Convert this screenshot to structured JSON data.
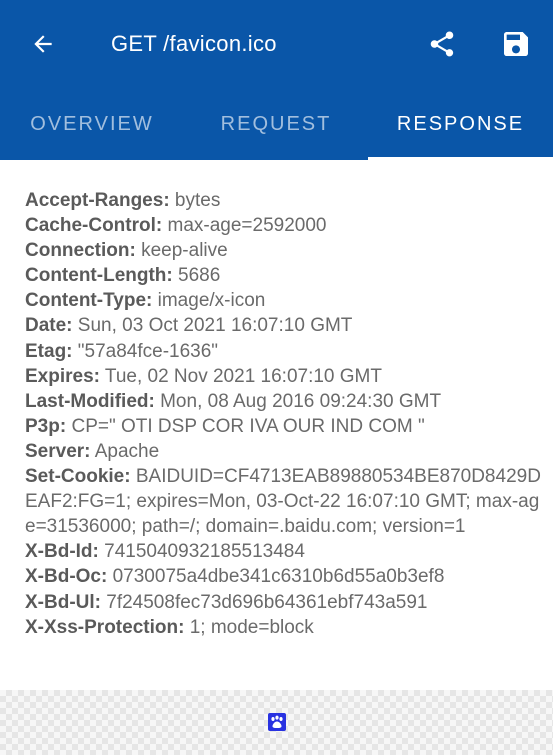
{
  "toolbar": {
    "title": "GET /favicon.ico",
    "back_icon": "arrow-back-icon",
    "share_icon": "share-icon",
    "save_icon": "save-icon"
  },
  "tabs": [
    {
      "label": "OVERVIEW",
      "selected": false
    },
    {
      "label": "REQUEST",
      "selected": false
    },
    {
      "label": "RESPONSE",
      "selected": true
    }
  ],
  "headers": [
    {
      "name": "Accept-Ranges:",
      "value": " bytes"
    },
    {
      "name": "Cache-Control:",
      "value": " max-age=2592000"
    },
    {
      "name": "Connection:",
      "value": " keep-alive"
    },
    {
      "name": "Content-Length:",
      "value": " 5686"
    },
    {
      "name": "Content-Type:",
      "value": " image/x-icon"
    },
    {
      "name": "Date:",
      "value": " Sun, 03 Oct 2021 16:07:10 GMT"
    },
    {
      "name": "Etag:",
      "value": " \"57a84fce-1636\""
    },
    {
      "name": "Expires:",
      "value": " Tue, 02 Nov 2021 16:07:10 GMT"
    },
    {
      "name": "Last-Modified:",
      "value": " Mon, 08 Aug 2016 09:24:30 GMT"
    },
    {
      "name": "P3p:",
      "value": " CP=\" OTI DSP COR IVA OUR IND COM \""
    },
    {
      "name": "Server:",
      "value": " Apache"
    },
    {
      "name": "Set-Cookie:",
      "value": " BAIDUID=CF4713EAB89880534BE870D8429DEAF2:FG=1; expires=Mon, 03-Oct-22 16:07:10 GMT; max-age=31536000; path=/; domain=.baidu.com; version=1"
    },
    {
      "name": "X-Bd-Id:",
      "value": " 7415040932185513484"
    },
    {
      "name": "X-Bd-Oc:",
      "value": " 0730075a4dbe341c6310b6d55a0b3ef8"
    },
    {
      "name": "X-Bd-Ul:",
      "value": " 7f24508fec73d696b64361ebf743a591"
    },
    {
      "name": "X-Xss-Protection:",
      "value": " 1; mode=block"
    }
  ],
  "preview": {
    "icon": "baidu-paw-icon"
  },
  "colors": {
    "appbar": "#0a56a8",
    "text": "#5f5f5f",
    "favicon": "#2932e1"
  }
}
